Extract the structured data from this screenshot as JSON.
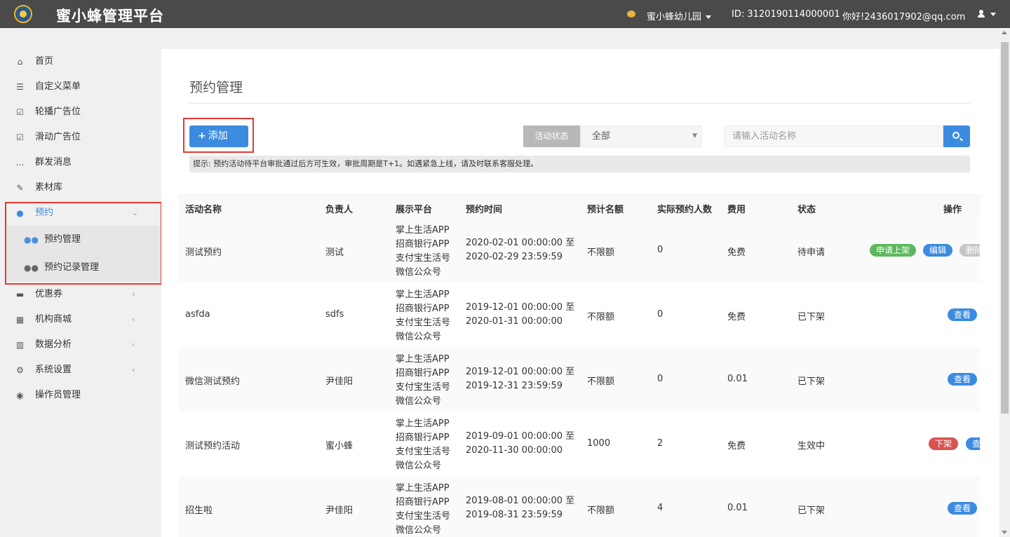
{
  "header": {
    "brand": "蜜小蜂管理平台",
    "org": "蜜小蜂幼儿园",
    "id_text": "ID:  3120190114000001",
    "greeting": "你好!2436017902@qq.com"
  },
  "sidebar": {
    "items": [
      {
        "label": "首页",
        "icon": "home-icon"
      },
      {
        "label": "自定义菜单",
        "icon": "list-icon"
      },
      {
        "label": "轮播广告位",
        "icon": "checkbox-icon"
      },
      {
        "label": "滑动广告位",
        "icon": "checkbox-outline-icon"
      },
      {
        "label": "群发消息",
        "icon": "chat-icon"
      },
      {
        "label": "素材库",
        "icon": "edit-icon"
      },
      {
        "label": "预约",
        "icon": "users-icon"
      },
      {
        "label": "优惠券",
        "icon": "ticket-icon"
      },
      {
        "label": "机构商城",
        "icon": "building-icon"
      },
      {
        "label": "数据分析",
        "icon": "bar-chart-icon"
      },
      {
        "label": "系统设置",
        "icon": "gears-icon"
      },
      {
        "label": "操作员管理",
        "icon": "user-circle-icon"
      }
    ],
    "subitems": [
      {
        "label": "预约管理",
        "icon": "users-icon"
      },
      {
        "label": "预约记录管理",
        "icon": "users-icon"
      }
    ]
  },
  "main": {
    "title": "预约管理",
    "add_label": "添加",
    "status_label": "活动状态",
    "status_value": "全部",
    "search_placeholder": "请输入活动名称",
    "hint": "提示:  预约活动待平台审批通过后方可生效，审批周期是T+1。如遇紧急上线，请及时联系客服处理。"
  },
  "table": {
    "headers": [
      "活动名称",
      "负责人",
      "展示平台",
      "预约时间",
      "预计名额",
      "实际预约人数",
      "费用",
      "状态",
      "操作"
    ],
    "rows": [
      {
        "name": "测试预约",
        "owner": "测试",
        "platforms": [
          "掌上生活APP",
          "招商银行APP",
          "支付宝生活号",
          "微信公众号"
        ],
        "time_start": "2020-02-01 00:00:00 至",
        "time_end": "2020-02-29 23:59:59",
        "quota": "不限额",
        "actual": "0",
        "fee": "免费",
        "status": "待申请",
        "actions": [
          "申请上架",
          "编辑",
          "删除"
        ]
      },
      {
        "name": "asfda",
        "owner": "sdfs",
        "platforms": [
          "掌上生活APP",
          "招商银行APP",
          "支付宝生活号",
          "微信公众号"
        ],
        "time_start": "2019-12-01 00:00:00 至",
        "time_end": "2020-01-31 00:00:00",
        "quota": "不限额",
        "actual": "0",
        "fee": "免费",
        "status": "已下架",
        "actions": [
          "查看"
        ]
      },
      {
        "name": "微信测试预约",
        "owner": "尹佳阳",
        "platforms": [
          "掌上生活APP",
          "招商银行APP",
          "支付宝生活号",
          "微信公众号"
        ],
        "time_start": "2019-12-01 00:00:00 至",
        "time_end": "2019-12-31 23:59:59",
        "quota": "不限额",
        "actual": "0",
        "fee": "0.01",
        "status": "已下架",
        "actions": [
          "查看"
        ]
      },
      {
        "name": "测试预约活动",
        "owner": "蜜小蜂",
        "platforms": [
          "掌上生活APP",
          "招商银行APP",
          "支付宝生活号",
          "微信公众号"
        ],
        "time_start": "2019-09-01 00:00:00 至",
        "time_end": "2020-11-30 00:00:00",
        "quota": "1000",
        "actual": "2",
        "fee": "免费",
        "status": "生效中",
        "actions": [
          "下架",
          "查看"
        ]
      },
      {
        "name": "招生啦",
        "owner": "尹佳阳",
        "platforms": [
          "掌上生活APP",
          "招商银行APP",
          "支付宝生活号",
          "微信公众号"
        ],
        "time_start": "2019-08-01 00:00:00 至",
        "time_end": "2019-08-31 23:59:59",
        "quota": "不限额",
        "actual": "4",
        "fee": "0.01",
        "status": "已下架",
        "actions": [
          "查看"
        ]
      }
    ]
  },
  "colors": {
    "accent": "#3b8be0",
    "topbar": "#4a4a4a",
    "highlight": "#e53935",
    "success": "#5cb85c",
    "danger": "#d9534f"
  }
}
